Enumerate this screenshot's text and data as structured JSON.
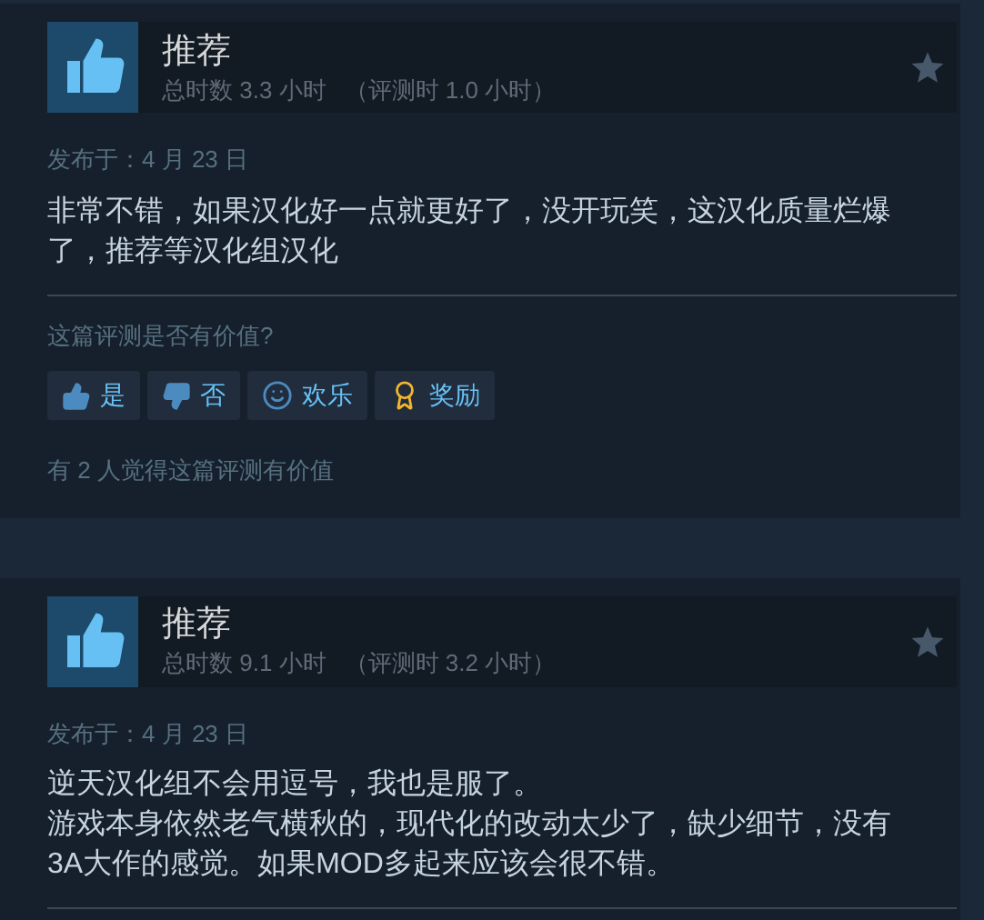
{
  "reviews": [
    {
      "recommended": true,
      "verdict": "推荐",
      "hours": "总时数 3.3 小时",
      "review_hours": "（评测时 1.0 小时）",
      "posted": "发布于：4 月 23 日",
      "body": [
        "非常不错，如果汉化好一点就更好了，没开玩笑，这汉化质量烂爆了，推荐等汉化组汉化"
      ],
      "helpful_question": "这篇评测是否有价值?",
      "buttons": [
        {
          "kind": "yes",
          "label": "是"
        },
        {
          "kind": "no",
          "label": "否"
        },
        {
          "kind": "funny",
          "label": "欢乐"
        },
        {
          "kind": "award",
          "label": "奖励"
        }
      ],
      "helpful_count": "有 2 人觉得这篇评测有价值"
    },
    {
      "recommended": true,
      "verdict": "推荐",
      "hours": "总时数 9.1 小时",
      "review_hours": "（评测时 3.2 小时）",
      "posted": "发布于：4 月 23 日",
      "body": [
        "逆天汉化组不会用逗号，我也是服了。",
        "游戏本身依然老气横秋的，现代化的改动太少了，缺少细节，没有3A大作的感觉。如果MOD多起来应该会很不错。"
      ]
    }
  ]
}
